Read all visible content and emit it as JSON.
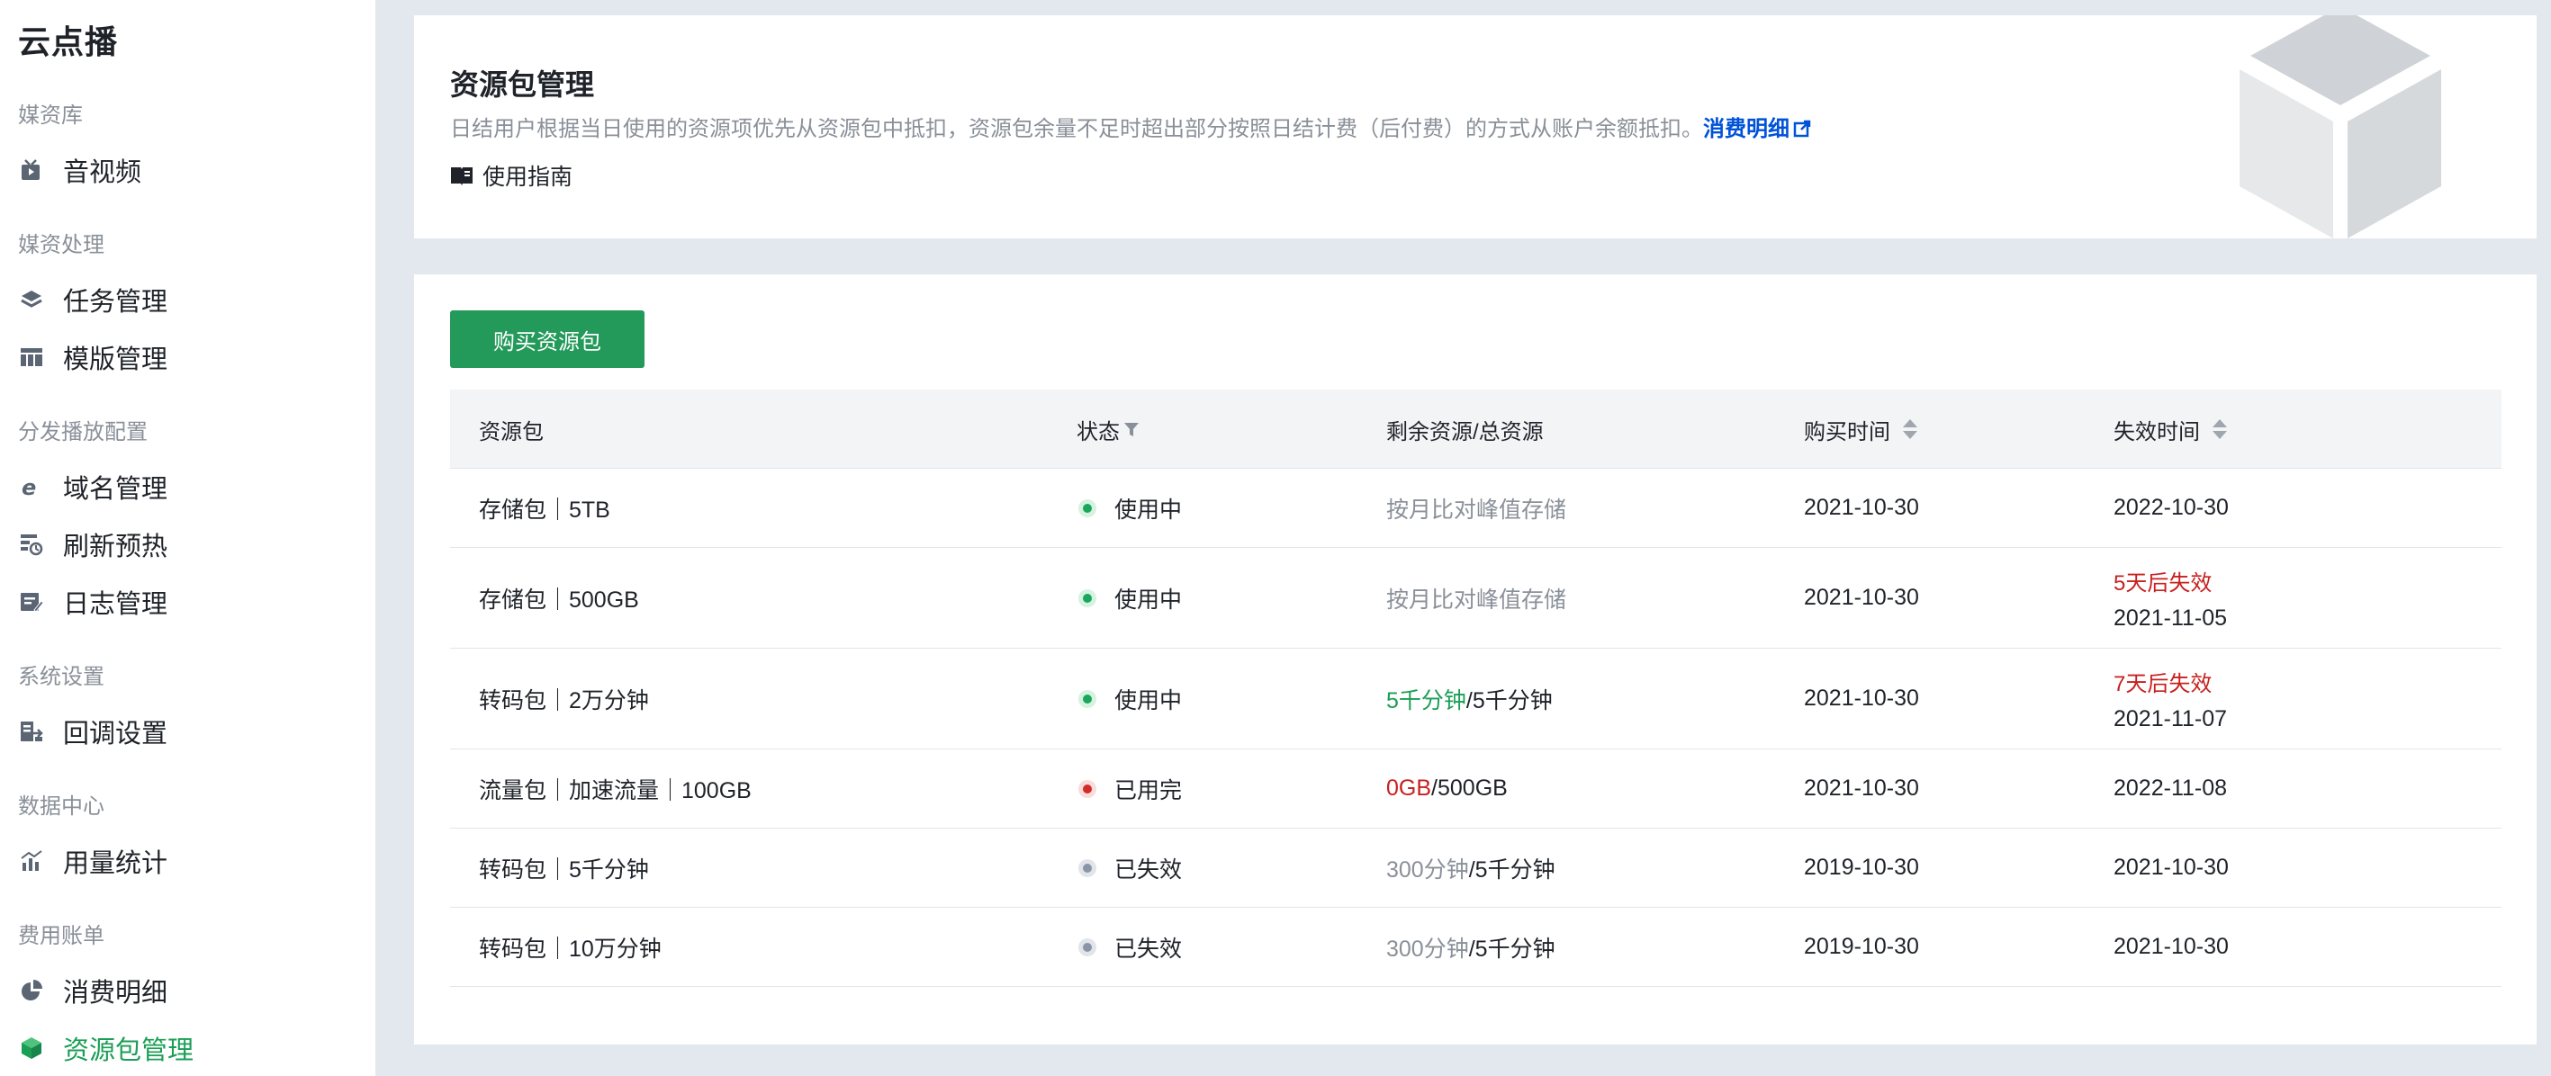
{
  "sidebar": {
    "title": "云点播",
    "groups": [
      {
        "label": "媒资库",
        "items": [
          {
            "label": "音视频",
            "icon": "video-icon"
          }
        ]
      },
      {
        "label": "媒资处理",
        "items": [
          {
            "label": "任务管理",
            "icon": "layers-icon"
          },
          {
            "label": "模版管理",
            "icon": "template-icon"
          }
        ]
      },
      {
        "label": "分发播放配置",
        "items": [
          {
            "label": "域名管理",
            "icon": "domain-icon"
          },
          {
            "label": "刷新预热",
            "icon": "refresh-icon"
          },
          {
            "label": "日志管理",
            "icon": "log-icon"
          }
        ]
      },
      {
        "label": "系统设置",
        "items": [
          {
            "label": "回调设置",
            "icon": "callback-icon"
          }
        ]
      },
      {
        "label": "数据中心",
        "items": [
          {
            "label": "用量统计",
            "icon": "chart-icon"
          }
        ]
      },
      {
        "label": "费用账单",
        "items": [
          {
            "label": "消费明细",
            "icon": "pie-icon"
          },
          {
            "label": "资源包管理",
            "icon": "package-icon",
            "active": true
          }
        ]
      }
    ]
  },
  "header": {
    "title": "资源包管理",
    "description": "日结用户根据当日使用的资源项优先从资源包中抵扣，资源包余量不足时超出部分按照日结计费（后付费）的方式从账户余额抵扣。",
    "link_label": "消费明细",
    "guide_label": "使用指南"
  },
  "toolbar": {
    "buy_label": "购买资源包"
  },
  "table": {
    "columns": [
      "资源包",
      "状态",
      "剩余资源/总资源",
      "购买时间",
      "失效时间"
    ],
    "rows": [
      {
        "package": "存储包｜5TB",
        "status": "使用中",
        "status_type": "green",
        "remaining": "按月比对峰值存储",
        "total": "",
        "remaining_style": "muted",
        "buy_time": "2021-10-30",
        "expire_warn": "",
        "expire_time": "2022-10-30"
      },
      {
        "package": "存储包｜500GB",
        "status": "使用中",
        "status_type": "green",
        "remaining": "按月比对峰值存储",
        "total": "",
        "remaining_style": "muted",
        "buy_time": "2021-10-30",
        "expire_warn": "5天后失效",
        "expire_time": "2021-11-05"
      },
      {
        "package": "转码包｜2万分钟",
        "status": "使用中",
        "status_type": "green",
        "remaining": "5千分钟",
        "total": "/5千分钟",
        "remaining_style": "green",
        "buy_time": "2021-10-30",
        "expire_warn": "7天后失效",
        "expire_time": "2021-11-07"
      },
      {
        "package": "流量包｜加速流量｜100GB",
        "status": "已用完",
        "status_type": "red",
        "remaining": "0GB",
        "total": "/500GB",
        "remaining_style": "red",
        "buy_time": "2021-10-30",
        "expire_warn": "",
        "expire_time": "2022-11-08"
      },
      {
        "package": "转码包｜5千分钟",
        "status": "已失效",
        "status_type": "gray",
        "remaining": "300分钟",
        "total": "/5千分钟",
        "remaining_style": "muted",
        "buy_time": "2019-10-30",
        "expire_warn": "",
        "expire_time": "2021-10-30"
      },
      {
        "package": "转码包｜10万分钟",
        "status": "已失效",
        "status_type": "gray",
        "remaining": "300分钟",
        "total": "/5千分钟",
        "remaining_style": "muted",
        "buy_time": "2019-10-30",
        "expire_warn": "",
        "expire_time": "2021-10-30"
      }
    ]
  }
}
